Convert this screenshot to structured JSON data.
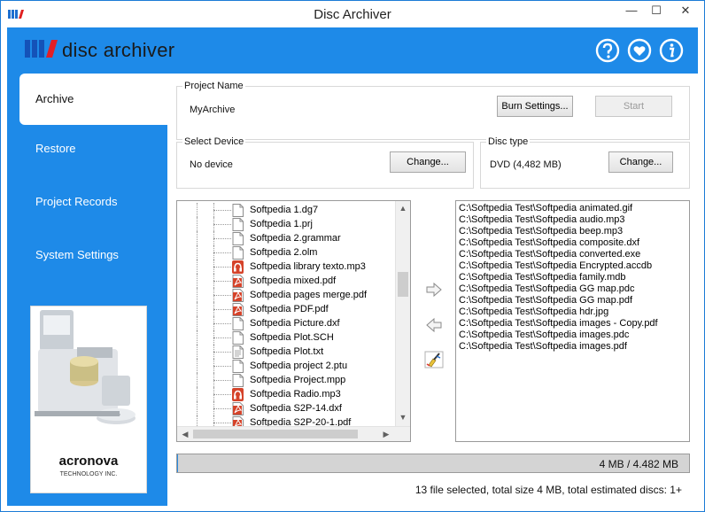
{
  "window": {
    "title": "Disc Archiver",
    "min_glyph": "—",
    "max_glyph": "☐",
    "close_glyph": "✕"
  },
  "brand": {
    "name": "disc archiver",
    "accent": "#1e8ae8"
  },
  "topbar_icons": [
    "help-icon",
    "heart-icon",
    "info-icon"
  ],
  "nav": [
    {
      "label": "Archive",
      "active": true
    },
    {
      "label": "Restore",
      "active": false
    },
    {
      "label": "Project Records",
      "active": false
    },
    {
      "label": "System Settings",
      "active": false
    }
  ],
  "promo": {
    "logo_text": "acronova",
    "tagline": "TECHNOLOGY INC."
  },
  "project": {
    "label": "Project Name",
    "value": "MyArchive",
    "burn_settings": "Burn Settings...",
    "start": "Start"
  },
  "device": {
    "label": "Select Device",
    "value": "No device",
    "change": "Change..."
  },
  "disc": {
    "label": "Disc type",
    "value": "DVD (4,482 MB)",
    "change": "Change..."
  },
  "tree_files": [
    {
      "name": "Softpedia 1.dg7",
      "icon": "file-icon"
    },
    {
      "name": "Softpedia 1.prj",
      "icon": "file-icon"
    },
    {
      "name": "Softpedia 2.grammar",
      "icon": "file-icon"
    },
    {
      "name": "Softpedia 2.olm",
      "icon": "file-icon"
    },
    {
      "name": "Softpedia library texto.mp3",
      "icon": "audio-file-icon"
    },
    {
      "name": "Softpedia mixed.pdf",
      "icon": "pdf-file-icon"
    },
    {
      "name": "Softpedia pages merge.pdf",
      "icon": "pdf-file-icon"
    },
    {
      "name": "Softpedia PDF.pdf",
      "icon": "pdf-file-icon"
    },
    {
      "name": "Softpedia Picture.dxf",
      "icon": "file-icon"
    },
    {
      "name": "Softpedia Plot.SCH",
      "icon": "file-icon"
    },
    {
      "name": "Softpedia Plot.txt",
      "icon": "text-file-icon"
    },
    {
      "name": "Softpedia project 2.ptu",
      "icon": "file-icon"
    },
    {
      "name": "Softpedia Project.mpp",
      "icon": "file-icon"
    },
    {
      "name": "Softpedia Radio.mp3",
      "icon": "audio-file-icon"
    },
    {
      "name": "Softpedia S2P-14.dxf",
      "icon": "pdf-file-icon"
    },
    {
      "name": "Softpedia S2P-20-1.pdf",
      "icon": "pdf-file-icon"
    }
  ],
  "selected_files": [
    "C:\\Softpedia Test\\Softpedia animated.gif",
    "C:\\Softpedia Test\\Softpedia audio.mp3",
    "C:\\Softpedia Test\\Softpedia beep.mp3",
    "C:\\Softpedia Test\\Softpedia composite.dxf",
    "C:\\Softpedia Test\\Softpedia converted.exe",
    "C:\\Softpedia Test\\Softpedia Encrypted.accdb",
    "C:\\Softpedia Test\\Softpedia family.mdb",
    "C:\\Softpedia Test\\Softpedia GG map.pdc",
    "C:\\Softpedia Test\\Softpedia GG map.pdf",
    "C:\\Softpedia Test\\Softpedia hdr.jpg",
    "C:\\Softpedia Test\\Softpedia images - Copy.pdf",
    "C:\\Softpedia Test\\Softpedia images.pdc",
    "C:\\Softpedia Test\\Softpedia images.pdf"
  ],
  "progress": {
    "text": "4 MB / 4.482 MB",
    "fraction": 0.001
  },
  "status": "13 file selected, total size 4 MB, total estimated discs: 1+"
}
